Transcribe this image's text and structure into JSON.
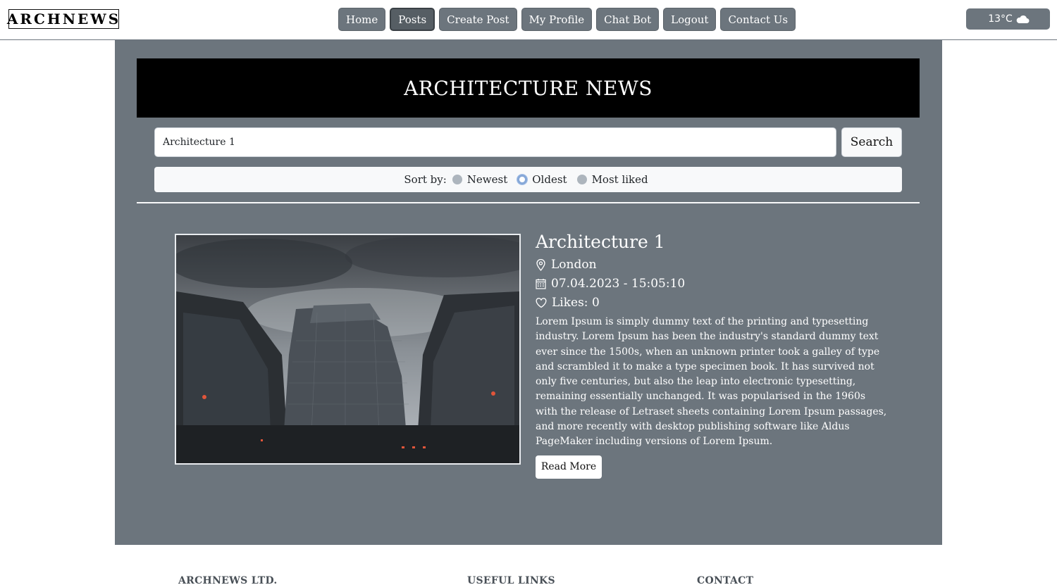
{
  "brand": {
    "logo": "ARCHNEWS"
  },
  "nav": {
    "items": [
      {
        "label": "Home",
        "active": false
      },
      {
        "label": "Posts",
        "active": true
      },
      {
        "label": "Create Post",
        "active": false
      },
      {
        "label": "My Profile",
        "active": false
      },
      {
        "label": "Chat Bot",
        "active": false
      },
      {
        "label": "Logout",
        "active": false
      },
      {
        "label": "Contact Us",
        "active": false
      }
    ]
  },
  "weather": {
    "temperature": "13°C",
    "icon": "cloud-icon"
  },
  "banner": {
    "title": "ARCHITECTURE NEWS"
  },
  "search": {
    "value": "Architecture 1",
    "button_label": "Search"
  },
  "sort": {
    "label": "Sort by:",
    "options": [
      {
        "label": "Newest",
        "checked": false
      },
      {
        "label": "Oldest",
        "checked": true
      },
      {
        "label": "Most liked",
        "checked": false
      }
    ]
  },
  "post": {
    "title": "Architecture 1",
    "location": "London",
    "datetime": "07.04.2023 - 15:05:10",
    "likes": "Likes: 0",
    "body": "Lorem Ipsum is simply dummy text of the printing and typesetting industry. Lorem Ipsum has been the industry's standard dummy text ever since the 1500s, when an unknown printer took a galley of type and scrambled it to make a type specimen book. It has survived not only five centuries, but also the leap into electronic typesetting, remaining essentially unchanged. It was popularised in the 1960s with the release of Letraset sheets containing Lorem Ipsum passages, and more recently with desktop publishing software like Aldus PageMaker including versions of Lorem Ipsum.",
    "read_more": "Read More"
  },
  "footer": {
    "company": "ARCHNEWS LTD.",
    "links_title": "USEFUL LINKS",
    "contact_title": "CONTACT"
  },
  "colors": {
    "nav_button": "#6c757d",
    "panel": "#6c757d",
    "banner": "#000000"
  }
}
